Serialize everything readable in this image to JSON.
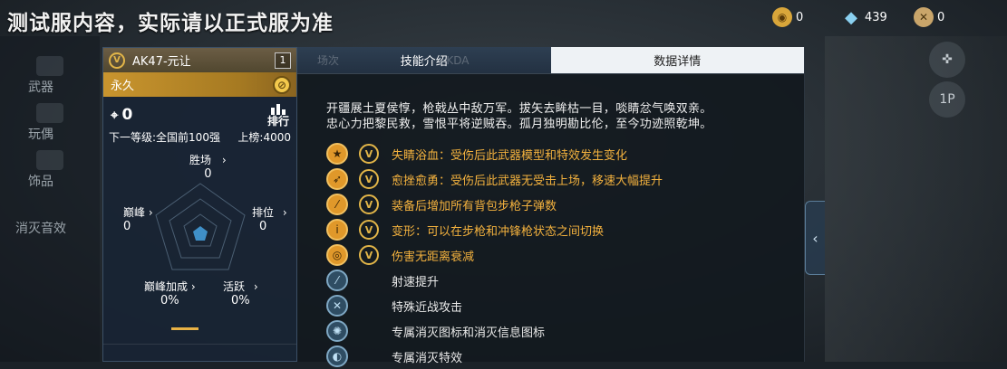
{
  "watermark": "测试服内容，实际请以正式服为准",
  "currency": [
    {
      "icon": "gold-coin-icon",
      "value": "0",
      "color": "#d9a63a"
    },
    {
      "icon": "diamond-icon",
      "value": "439",
      "color": "#8ad0f0"
    },
    {
      "icon": "token-icon",
      "value": "0",
      "color": "#c9a56a"
    }
  ],
  "left_menu": [
    "武器",
    "玩偶",
    "饰品",
    "消灭音效"
  ],
  "right_icons": [
    "✜",
    "1P"
  ],
  "weapon": {
    "name": "AK47-元让",
    "tier_badge": "V",
    "level": "1",
    "duration": "永久",
    "kills": "0",
    "rank_label": "排行",
    "next_level": "下一等级:全国前100强",
    "listed": "上榜:4000",
    "stats": {
      "wins": {
        "label": "胜场",
        "value": "0"
      },
      "peak": {
        "label": "巅峰",
        "value": "0"
      },
      "rank": {
        "label": "排位",
        "value": "0"
      },
      "peak_bonus": {
        "label": "巅峰加成",
        "value": "0%"
      },
      "active": {
        "label": "活跃",
        "value": "0%"
      }
    },
    "arrow": "›"
  },
  "tabs": {
    "ghost_left": "场次",
    "ghost_right": "KDA",
    "skills": "技能介绍",
    "data": "数据详情"
  },
  "intro_lines": [
    "开疆展土夏侯惇，枪戟丛中敌万军。拔矢去眸枯一目，啖睛忿气唤双亲。",
    "忠心力把黎民救，雪恨平将逆贼吞。孤月独明勘比伦，至今功迹照乾坤。"
  ],
  "skills": [
    {
      "text": "失睛浴血：受伤后此武器模型和特效发生变化",
      "type": "gold",
      "glyph": "★",
      "badge": "V"
    },
    {
      "text": "愈挫愈勇：受伤后此武器无受击上场，移速大幅提升",
      "type": "gold",
      "glyph": "➶",
      "badge": "V"
    },
    {
      "text": "装备后增加所有背包步枪子弹数",
      "type": "gold",
      "glyph": "⁄",
      "badge": "V"
    },
    {
      "text": "变形：可以在步枪和冲锋枪状态之间切换",
      "type": "gold",
      "glyph": "ⅰ",
      "badge": "V"
    },
    {
      "text": "伤害无距离衰减",
      "type": "gold",
      "glyph": "◎",
      "badge": "V"
    },
    {
      "text": "射速提升",
      "type": "blue",
      "glyph": "⁄",
      "badge": ""
    },
    {
      "text": "特殊近战攻击",
      "type": "blue",
      "glyph": "✕",
      "badge": ""
    },
    {
      "text": "专属消灭图标和消灭信息图标",
      "type": "blue",
      "glyph": "✺",
      "badge": ""
    },
    {
      "text": "专属消灭特效",
      "type": "blue",
      "glyph": "◐",
      "badge": ""
    }
  ],
  "collapse_glyph": "‹"
}
